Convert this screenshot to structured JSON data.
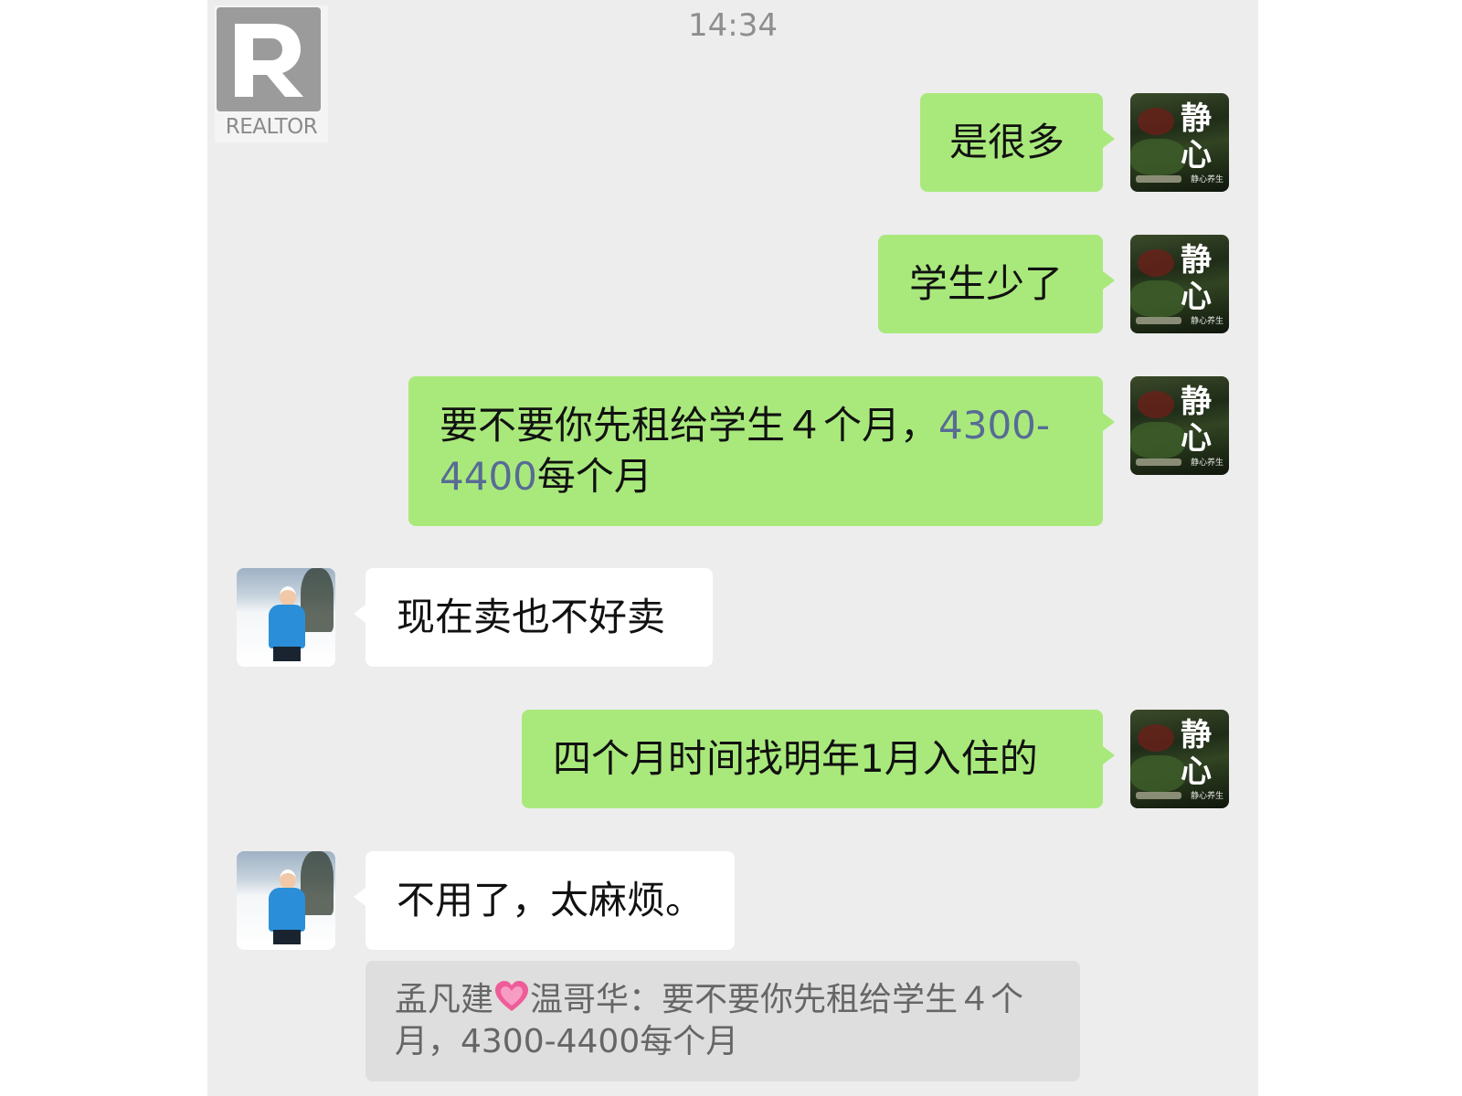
{
  "status": {
    "time": "14:34"
  },
  "watermark": {
    "brand": "REALTOR"
  },
  "self_avatar": {
    "big_text": "静心",
    "small_text": "静心养生"
  },
  "messages": [
    {
      "side": "right",
      "text": "是很多"
    },
    {
      "side": "right",
      "text": "学生少了"
    },
    {
      "side": "right",
      "text_pre": "要不要你先租给学生４个月，",
      "num1": "4300-",
      "num2": "4400",
      "text_post": "每个月"
    },
    {
      "side": "left",
      "text": "现在卖也不好卖"
    },
    {
      "side": "right",
      "text": "四个月时间找明年1月入住的"
    },
    {
      "side": "left",
      "text": "不用了，太麻烦。"
    }
  ],
  "quote": {
    "sender_pre": "孟凡建",
    "emoji": "heart-icon",
    "sender_post": "温哥华：",
    "text_line1": "要不要你先租给学生４个",
    "text_line2": "月，4300-4400每个月"
  },
  "colors": {
    "chat_bg": "#ededed",
    "bubble_self": "#a9e97c",
    "bubble_other": "#ffffff",
    "link_number": "#576b95",
    "quote_bg": "#dedede"
  }
}
